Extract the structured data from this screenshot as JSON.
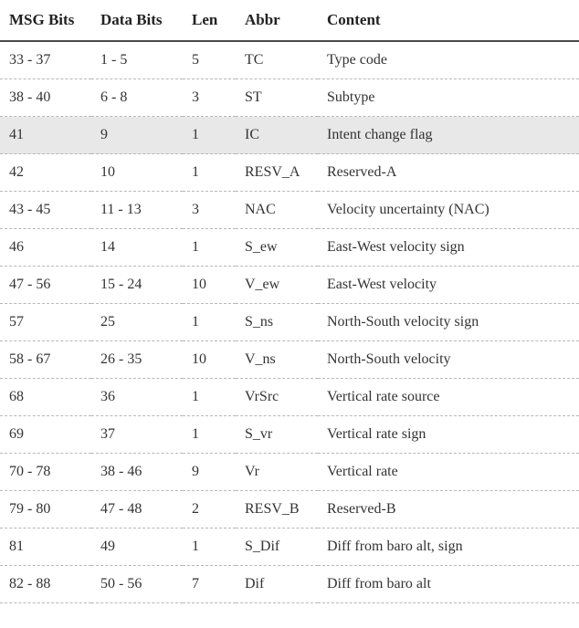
{
  "table": {
    "headers": [
      "MSG Bits",
      "Data Bits",
      "Len",
      "Abbr",
      "Content"
    ],
    "rows": [
      {
        "msg": "33 - 37",
        "data": "1 - 5",
        "len": "5",
        "abbr": "TC",
        "content": "Type code",
        "highlight": false
      },
      {
        "msg": "38 - 40",
        "data": "6 - 8",
        "len": "3",
        "abbr": "ST",
        "content": "Subtype",
        "highlight": false
      },
      {
        "msg": "41",
        "data": "9",
        "len": "1",
        "abbr": "IC",
        "content": "Intent change flag",
        "highlight": true
      },
      {
        "msg": "42",
        "data": "10",
        "len": "1",
        "abbr": "RESV_A",
        "content": "Reserved-A",
        "highlight": false
      },
      {
        "msg": "43 - 45",
        "data": "11 - 13",
        "len": "3",
        "abbr": "NAC",
        "content": "Velocity uncertainty (NAC)",
        "highlight": false
      },
      {
        "msg": "46",
        "data": "14",
        "len": "1",
        "abbr": "S_ew",
        "content": "East-West velocity sign",
        "highlight": false
      },
      {
        "msg": "47 - 56",
        "data": "15 - 24",
        "len": "10",
        "abbr": "V_ew",
        "content": "East-West velocity",
        "highlight": false
      },
      {
        "msg": "57",
        "data": "25",
        "len": "1",
        "abbr": "S_ns",
        "content": "North-South velocity sign",
        "highlight": false
      },
      {
        "msg": "58 - 67",
        "data": "26 - 35",
        "len": "10",
        "abbr": "V_ns",
        "content": "North-South velocity",
        "highlight": false
      },
      {
        "msg": "68",
        "data": "36",
        "len": "1",
        "abbr": "VrSrc",
        "content": "Vertical rate source",
        "highlight": false
      },
      {
        "msg": "69",
        "data": "37",
        "len": "1",
        "abbr": "S_vr",
        "content": "Vertical rate sign",
        "highlight": false
      },
      {
        "msg": "70 - 78",
        "data": "38 - 46",
        "len": "9",
        "abbr": "Vr",
        "content": "Vertical rate",
        "highlight": false
      },
      {
        "msg": "79 - 80",
        "data": "47 - 48",
        "len": "2",
        "abbr": "RESV_B",
        "content": "Reserved-B",
        "highlight": false
      },
      {
        "msg": "81",
        "data": "49",
        "len": "1",
        "abbr": "S_Dif",
        "content": "Diff from baro alt, sign",
        "highlight": false
      },
      {
        "msg": "82 - 88",
        "data": "50 - 56",
        "len": "7",
        "abbr": "Dif",
        "content": "Diff from baro alt",
        "highlight": false
      }
    ]
  }
}
